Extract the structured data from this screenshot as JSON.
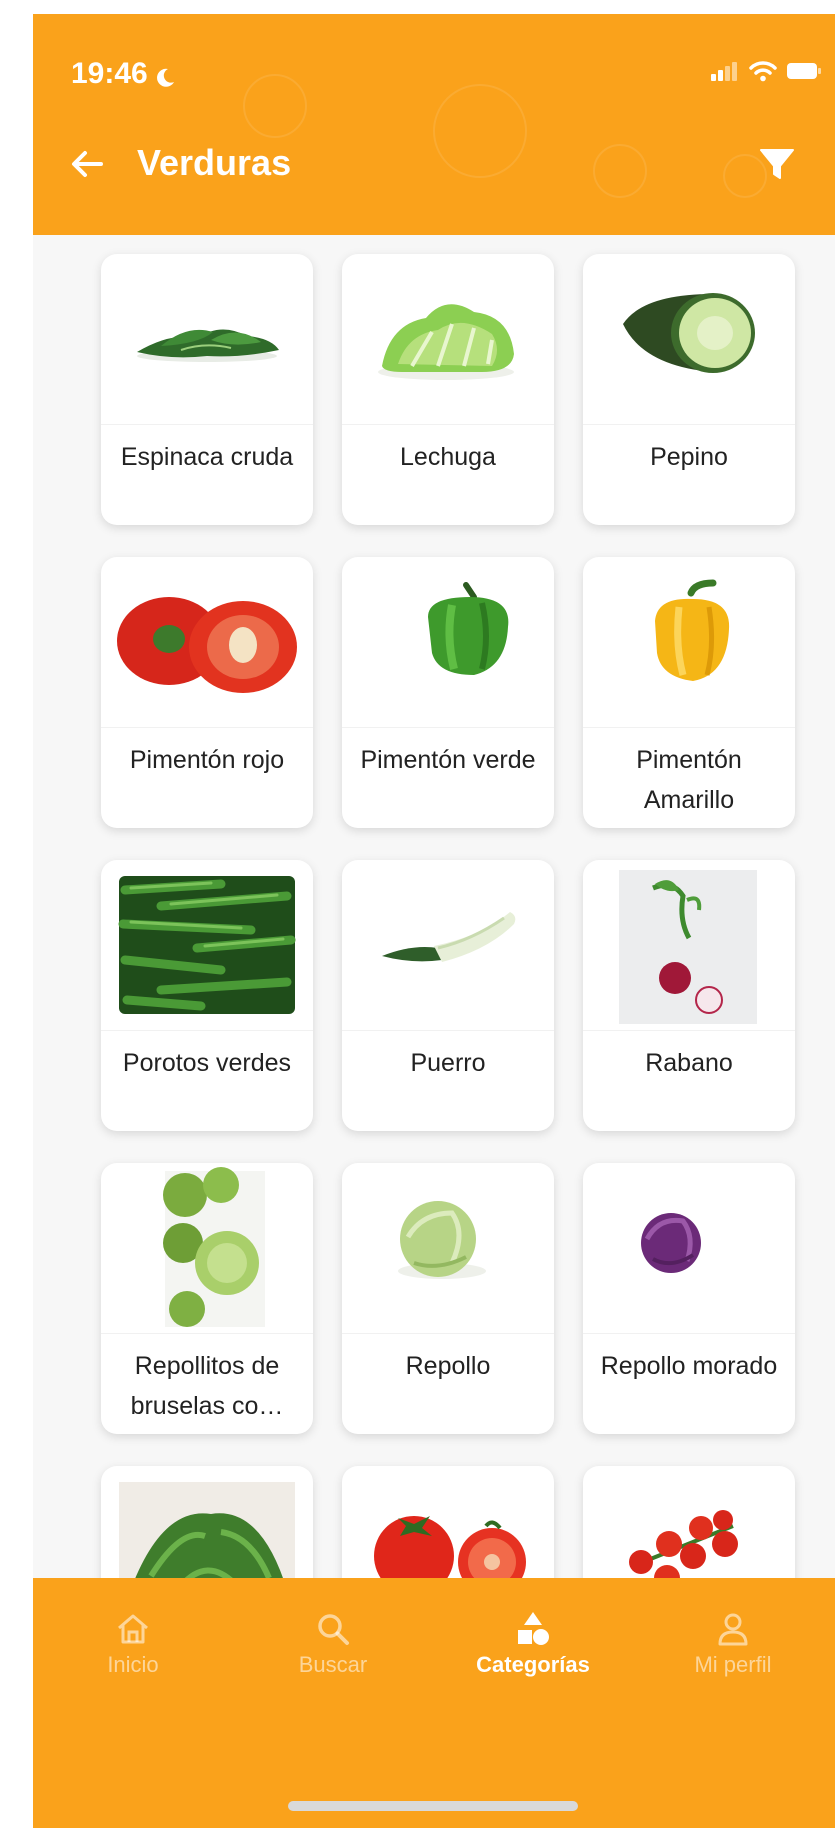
{
  "status_bar": {
    "time": "19:46"
  },
  "header": {
    "title": "Verduras"
  },
  "products": [
    {
      "name": "Espinaca cruda",
      "icon": "spinach-image"
    },
    {
      "name": "Lechuga",
      "icon": "lettuce-image"
    },
    {
      "name": "Pepino",
      "icon": "cucumber-image"
    },
    {
      "name": "Pimentón rojo",
      "icon": "red-pepper-image"
    },
    {
      "name": "Pimentón verde",
      "icon": "green-pepper-image"
    },
    {
      "name": "Pimentón Amarillo",
      "icon": "yellow-pepper-image"
    },
    {
      "name": "Porotos verdes",
      "icon": "green-beans-image"
    },
    {
      "name": "Puerro",
      "icon": "leek-image"
    },
    {
      "name": "Rabano",
      "icon": "radish-image"
    },
    {
      "name": "Repollitos de bruselas co…",
      "icon": "brussels-sprouts-image"
    },
    {
      "name": "Repollo",
      "icon": "cabbage-image"
    },
    {
      "name": "Repollo morado",
      "icon": "red-cabbage-image"
    },
    {
      "name": "",
      "icon": "arugula-image"
    },
    {
      "name": "",
      "icon": "tomato-image"
    },
    {
      "name": "",
      "icon": "cherry-tomato-image"
    }
  ],
  "tabbar": {
    "items": [
      {
        "label": "Inicio",
        "icon": "home-icon",
        "active": false
      },
      {
        "label": "Buscar",
        "icon": "search-icon",
        "active": false
      },
      {
        "label": "Categorías",
        "icon": "categories-icon",
        "active": true
      },
      {
        "label": "Mi perfil",
        "icon": "profile-icon",
        "active": false
      }
    ]
  },
  "colors": {
    "brand": "#faa21b",
    "background": "#f7f7f7",
    "card": "#ffffff"
  }
}
